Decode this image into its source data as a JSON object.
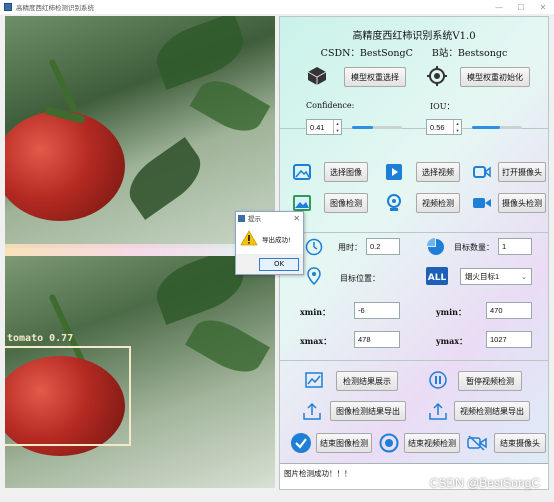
{
  "window": {
    "title": "高精度西红柿检测识别系统",
    "min": "—",
    "max": "☐",
    "close": "✕"
  },
  "detection": {
    "label": "tomato  0.77"
  },
  "header": {
    "title": "高精度西红柿识别系统V1.0",
    "csdn": "CSDN：BestSongC",
    "bilibili": "B站：Bestsongc"
  },
  "model": {
    "select_label": "模型权重选择",
    "init_label": "模型权重初始化"
  },
  "params": {
    "confidence_label": "Confidence:",
    "confidence_value": "0.41",
    "confidence_fraction": 0.41,
    "iou_label": "IOU：",
    "iou_value": "0.56",
    "iou_fraction": 0.56
  },
  "sources": {
    "select_image": "选择图像",
    "select_video": "选择视频",
    "open_camera": "打开摄像头",
    "image_detect": "图像检测",
    "video_detect": "视频检测",
    "camera_detect": "摄像头检测"
  },
  "stats": {
    "time_label": "用时：",
    "time_value": "0.2",
    "count_label": "目标数量：",
    "count_value": "1",
    "position_label": "目标位置：",
    "target_select": "烟火目标1",
    "xmin_label": "xmin：",
    "xmin_value": "-6",
    "ymin_label": "ymin：",
    "ymin_value": "470",
    "xmax_label": "xmax：",
    "xmax_value": "478",
    "ymax_label": "ymax：",
    "ymax_value": "1027"
  },
  "actions": {
    "show_result": "检测结果展示",
    "pause_video": "暂停视频检测",
    "export_image": "图像检测结果导出",
    "export_video": "视频检测结果导出",
    "end_image": "结束图像检测",
    "end_video": "结束视频检测",
    "end_camera": "结束摄像头"
  },
  "status": {
    "text": "图片检测成功！！！"
  },
  "dialog": {
    "title": "提示",
    "message": "导出成功!",
    "ok": "OK",
    "close": "✕"
  },
  "watermark": "CSDN @BestSongC",
  "colors": {
    "accent": "#2f8fe0",
    "panel_teal": "#c9f2ea",
    "panel_lilac": "#eadcf5"
  }
}
